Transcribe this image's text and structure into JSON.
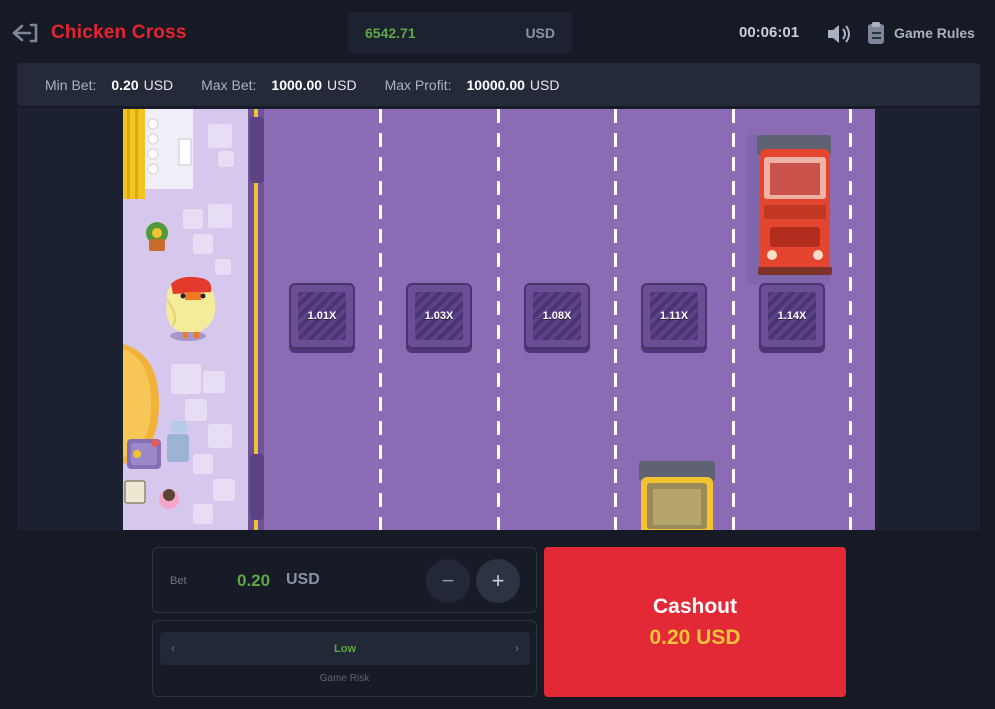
{
  "header": {
    "title": "Chicken Cross",
    "balance_value": "6542.71",
    "balance_currency": "USD",
    "timer": "00:06:01",
    "rules_label": "Game Rules"
  },
  "limits": {
    "min_bet_label": "Min Bet:",
    "min_bet_value": "0.20",
    "max_bet_label": "Max Bet:",
    "max_bet_value": "1000.00",
    "max_profit_label": "Max Profit:",
    "max_profit_value": "10000.00",
    "currency": "USD"
  },
  "lanes": {
    "multipliers": [
      "1.01X",
      "1.03X",
      "1.08X",
      "1.11X",
      "1.14X"
    ]
  },
  "bet": {
    "label": "Bet",
    "value": "0.20",
    "currency": "USD",
    "minus_symbol": "−",
    "plus_symbol": "+"
  },
  "risk": {
    "value": "Low",
    "caption": "Game Risk",
    "prev_symbol": "‹",
    "next_symbol": "›"
  },
  "cashout": {
    "label": "Cashout",
    "amount": "0.20 USD"
  },
  "icons": {
    "back": "back-arrow-icon",
    "sound": "speaker-icon",
    "rules": "clipboard-icon"
  },
  "colors": {
    "brand_red": "#e8222f",
    "balance_green": "#5fa746",
    "cashout_bg": "#e22935",
    "cashout_amount": "#f6c33a",
    "road": "#8a6bb4"
  }
}
